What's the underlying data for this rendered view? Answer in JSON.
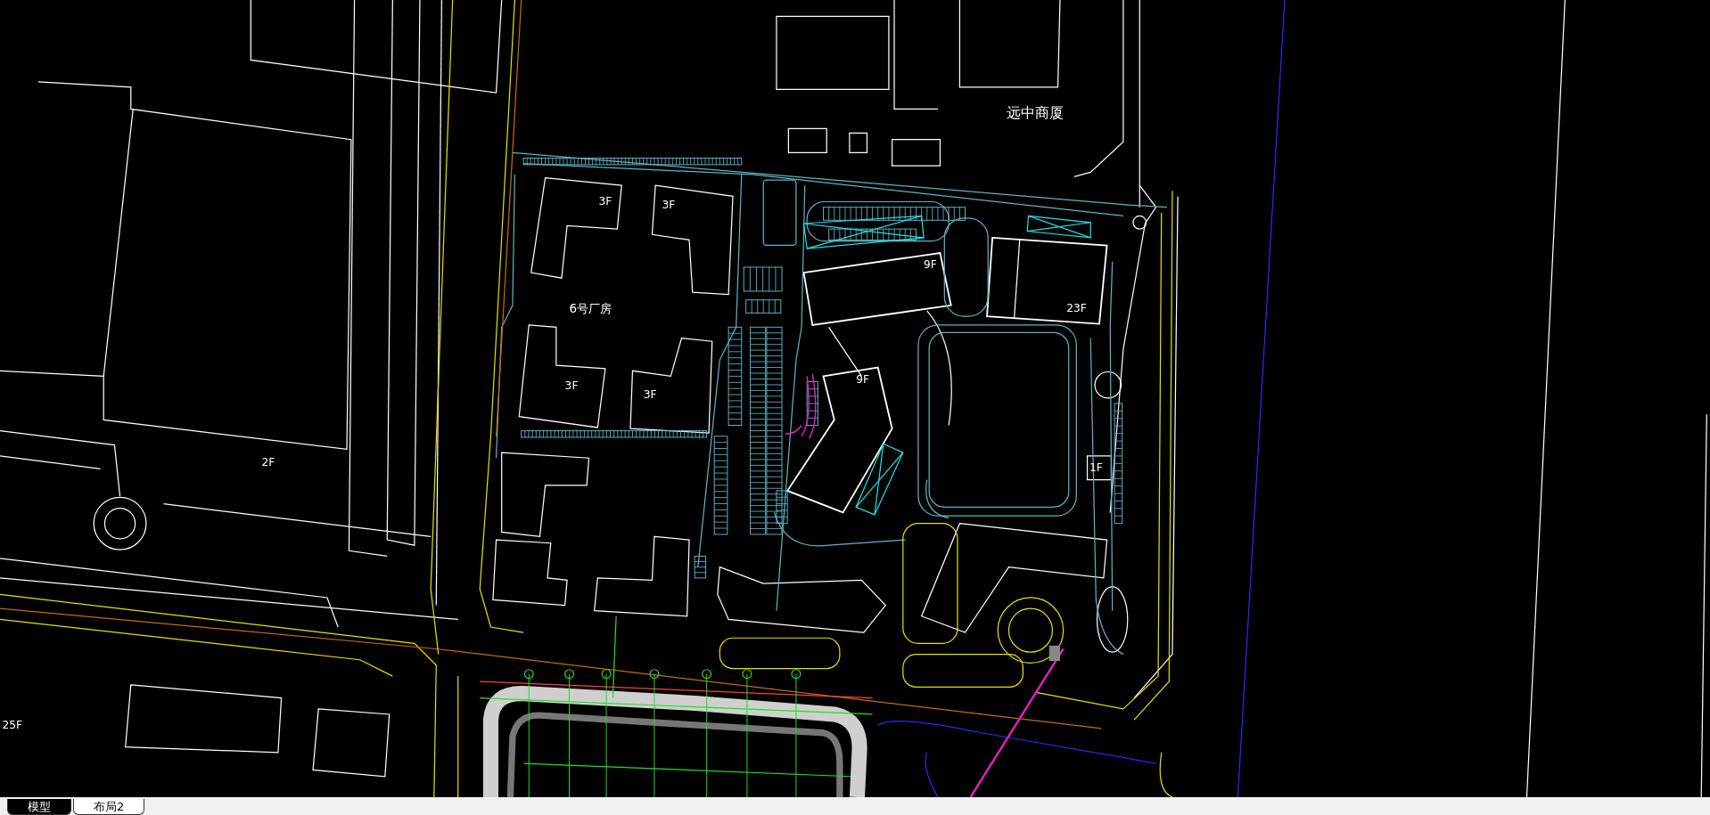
{
  "drawing": {
    "labels": [
      {
        "text": "远中商厦"
      },
      {
        "text": "3F"
      },
      {
        "text": "3F"
      },
      {
        "text": "9F"
      },
      {
        "text": "23F"
      },
      {
        "text": "6号厂房"
      },
      {
        "text": "3F"
      },
      {
        "text": "3F"
      },
      {
        "text": "9F"
      },
      {
        "text": "2F"
      },
      {
        "text": "1F"
      },
      {
        "text": "25F"
      }
    ]
  },
  "tabs": [
    {
      "label": "模型",
      "selected": true
    },
    {
      "label": "布局2",
      "selected": false
    }
  ]
}
